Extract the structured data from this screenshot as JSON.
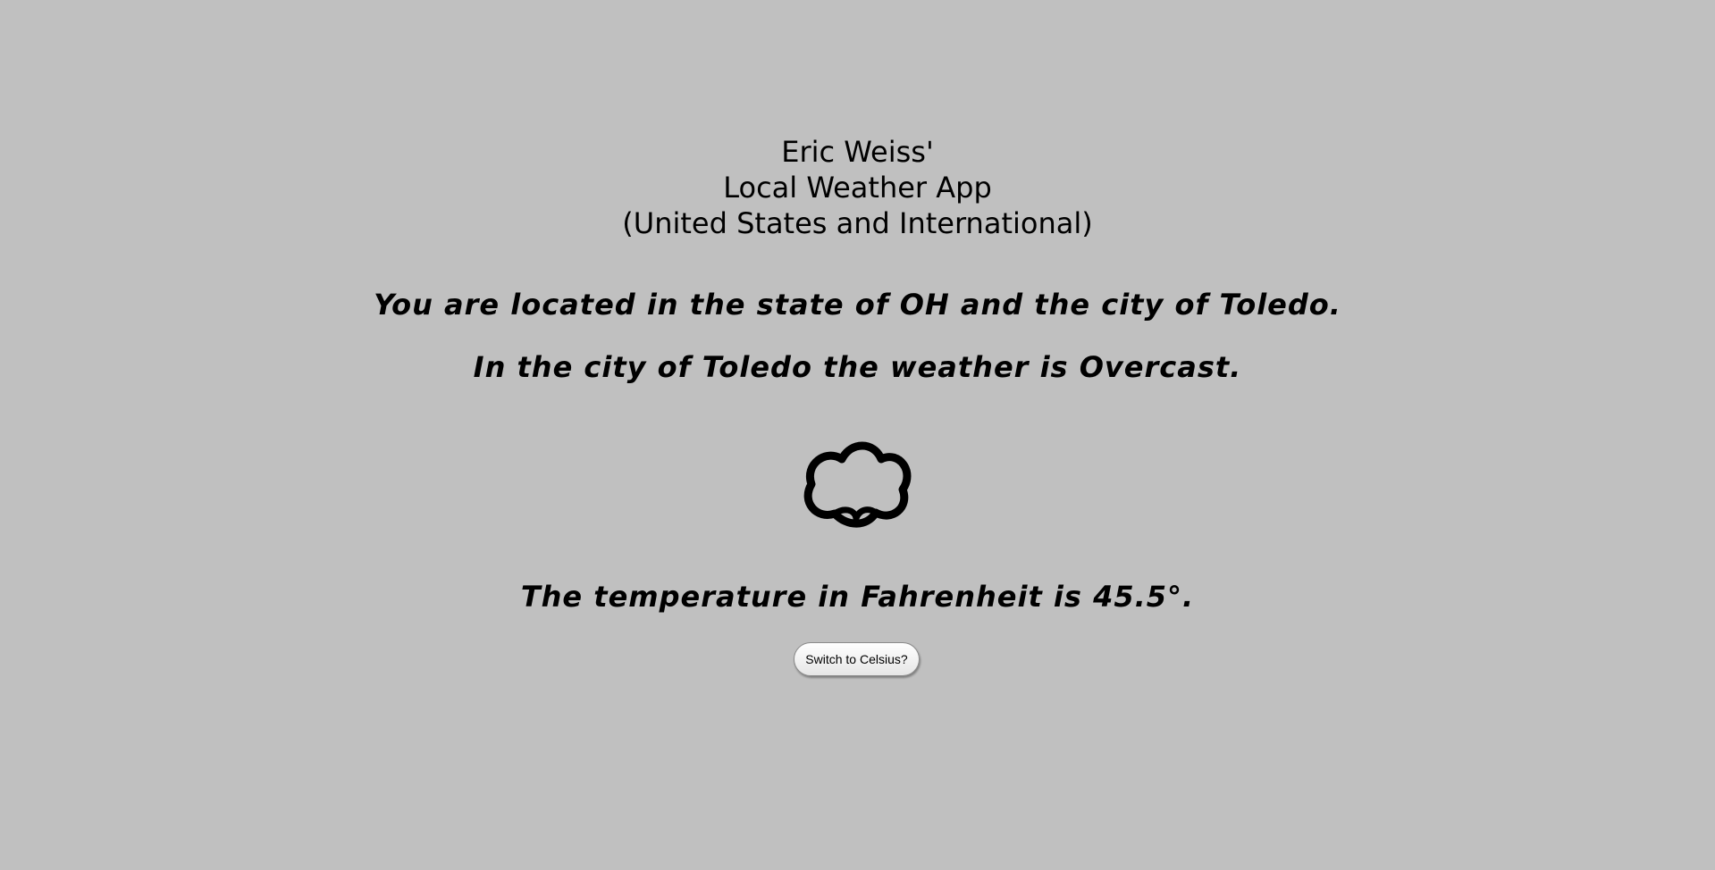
{
  "header": {
    "line1": "Eric Weiss'",
    "line2": "Local Weather App",
    "line3": "(United States and International)"
  },
  "location": {
    "text": "You are located in the state of OH and the city of Toledo."
  },
  "weather": {
    "text": "In the city of Toledo the weather is Overcast.",
    "icon": "cloud-icon"
  },
  "temperature": {
    "text": "The temperature in Fahrenheit is 45.5°."
  },
  "unit_toggle": {
    "label": "Switch to Celsius?"
  },
  "colors": {
    "background": "#c0c0c0",
    "text": "#000000"
  }
}
